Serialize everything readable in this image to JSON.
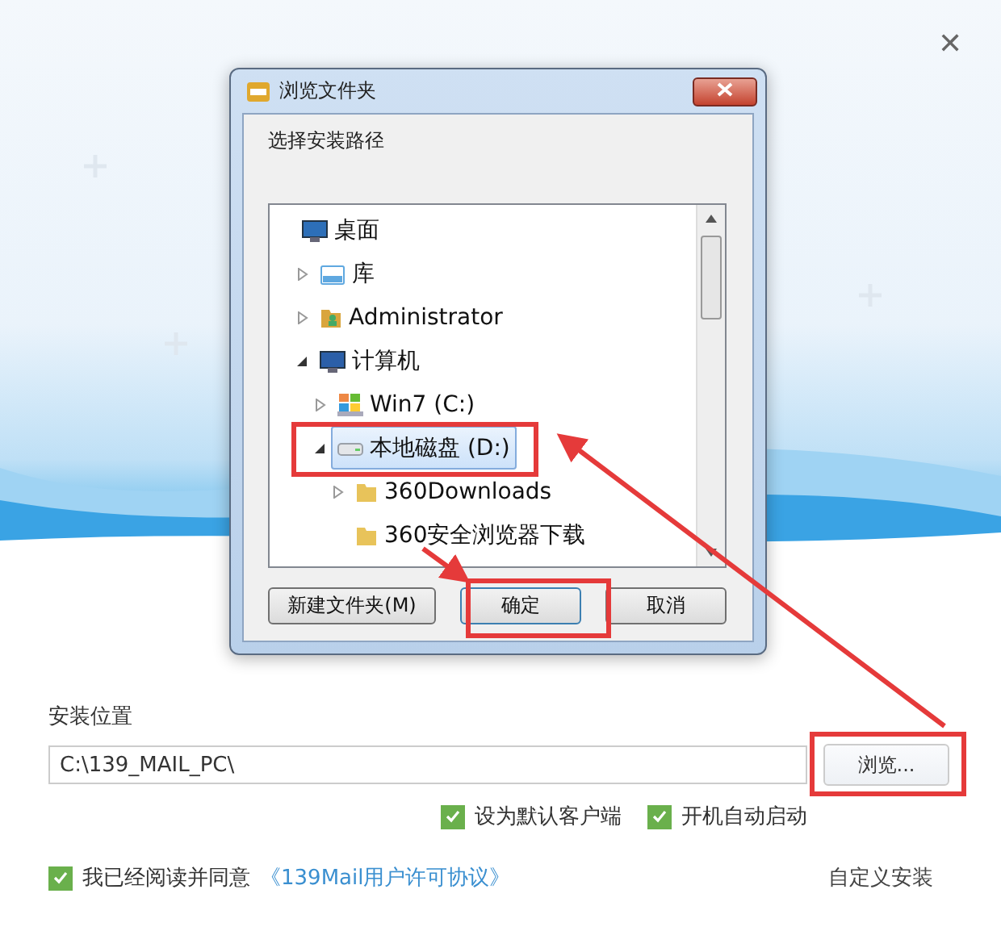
{
  "window": {
    "close_glyph": "✕"
  },
  "dialog": {
    "title": "浏览文件夹",
    "prompt": "选择安装路径",
    "tree": [
      {
        "label": "桌面",
        "kind": "desktop",
        "selected": false,
        "children": [
          {
            "label": "库",
            "kind": "library",
            "selected": false,
            "expanded": false
          },
          {
            "label": "Administrator",
            "kind": "user",
            "selected": false,
            "expanded": false
          },
          {
            "label": "计算机",
            "kind": "computer",
            "selected": false,
            "expanded": true,
            "children": [
              {
                "label": "Win7 (C:)",
                "kind": "system-drive",
                "selected": false,
                "expanded": false
              },
              {
                "label": "本地磁盘 (D:)",
                "kind": "drive",
                "selected": true,
                "expanded": true,
                "children": [
                  {
                    "label": "360Downloads",
                    "kind": "folder",
                    "selected": false,
                    "expanded": false
                  },
                  {
                    "label": "360安全浏览器下载",
                    "kind": "folder",
                    "selected": false
                  }
                ]
              }
            ]
          }
        ]
      }
    ],
    "buttons": [
      {
        "label": "新建文件夹(M)",
        "default": false
      },
      {
        "label": "确定",
        "default": true
      },
      {
        "label": "取消",
        "default": false
      }
    ]
  },
  "install": {
    "label": "安装位置",
    "path": "C:\\139_MAIL_PC\\",
    "browse": "浏览..."
  },
  "options": [
    {
      "label": "设为默认客户端",
      "checked": true
    },
    {
      "label": "开机自动启动",
      "checked": true
    }
  ],
  "agreement": {
    "label": "我已经阅读并同意",
    "checked": true,
    "link": "《139Mail用户许可协议》"
  },
  "custom_install": "自定义安装"
}
